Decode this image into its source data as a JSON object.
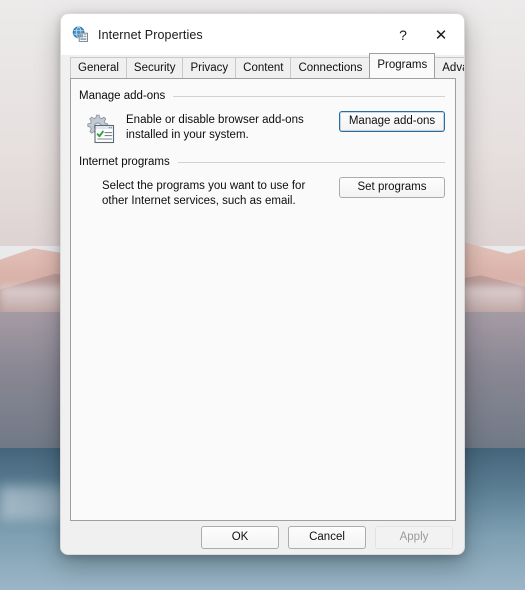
{
  "window": {
    "title": "Internet Properties",
    "icon": "internet-properties-icon",
    "help_label": "?",
    "close_label": "✕"
  },
  "tabs": [
    {
      "label": "General",
      "selected": false
    },
    {
      "label": "Security",
      "selected": false
    },
    {
      "label": "Privacy",
      "selected": false
    },
    {
      "label": "Content",
      "selected": false
    },
    {
      "label": "Connections",
      "selected": false
    },
    {
      "label": "Programs",
      "selected": true
    },
    {
      "label": "Advanced",
      "selected": false
    }
  ],
  "groups": [
    {
      "title": "Manage add-ons",
      "icon": "addons-gear-icon",
      "description_line1": "Enable or disable browser add-ons",
      "description_line2": "installed in your system.",
      "button_label": "Manage add-ons",
      "button_focused": true
    },
    {
      "title": "Internet programs",
      "icon": "",
      "description_line1": "Select the programs you want to use for",
      "description_line2": "other Internet services, such as email.",
      "button_label": "Set programs",
      "button_focused": false
    }
  ],
  "footer": {
    "ok_label": "OK",
    "cancel_label": "Cancel",
    "apply_label": "Apply",
    "apply_disabled": true
  },
  "colors": {
    "accent_focus": "#2b6b9e",
    "window_bg": "#f0f0f0",
    "panel_bg": "#fafafa",
    "titlebar_bg": "#ffffff",
    "border": "#9f9f9f",
    "disabled_text": "#9a9a9a"
  }
}
